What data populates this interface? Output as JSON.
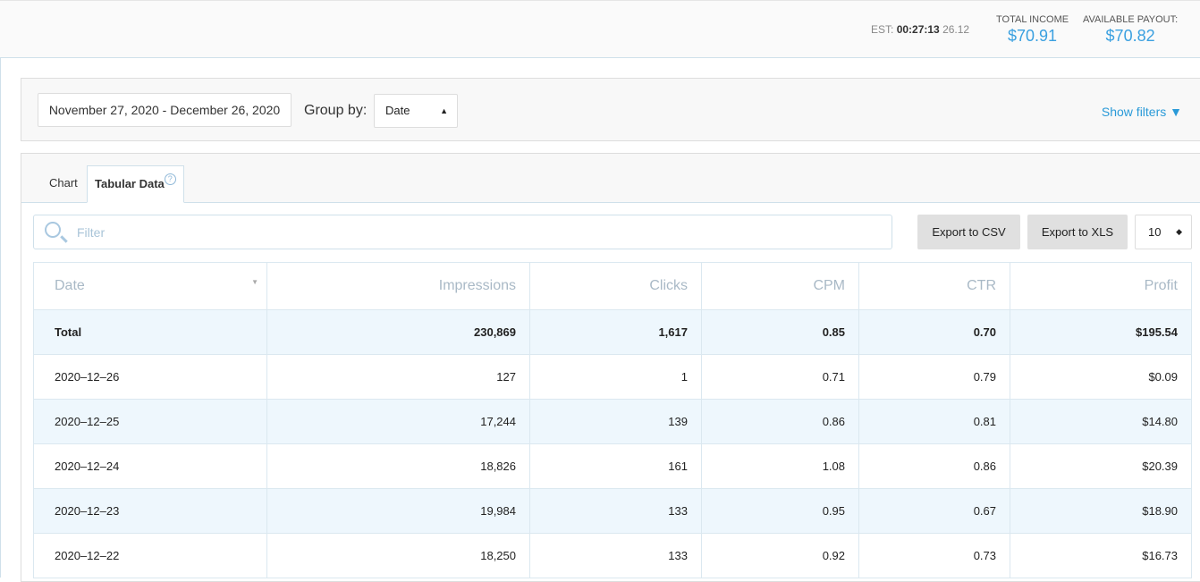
{
  "header": {
    "est_label": "EST:",
    "est_time": "00:27:13",
    "est_date": "26.12",
    "total_income_label": "TOTAL INCOME",
    "total_income": "$70.91",
    "payout_label": "AVAILABLE PAYOUT:",
    "payout": "$70.82"
  },
  "filters": {
    "date_range": "November 27, 2020 - December 26, 2020",
    "group_by_label": "Group by:",
    "group_by_value": "Date",
    "show_filters": "Show filters ▼"
  },
  "tabs": [
    {
      "label": "Chart"
    },
    {
      "label": "Tabular Data"
    }
  ],
  "toolbar": {
    "filter_placeholder": "Filter",
    "export_csv": "Export to CSV",
    "export_xls": "Export to XLS",
    "page_size": "10"
  },
  "table": {
    "columns": [
      "Date",
      "Impressions",
      "Clicks",
      "CPM",
      "CTR",
      "Profit"
    ],
    "rows": [
      [
        "Total",
        "230,869",
        "1,617",
        "0.85",
        "0.70",
        "$195.54"
      ],
      [
        "2020–12–26",
        "127",
        "1",
        "0.71",
        "0.79",
        "$0.09"
      ],
      [
        "2020–12–25",
        "17,244",
        "139",
        "0.86",
        "0.81",
        "$14.80"
      ],
      [
        "2020–12–24",
        "18,826",
        "161",
        "1.08",
        "0.86",
        "$20.39"
      ],
      [
        "2020–12–23",
        "19,984",
        "133",
        "0.95",
        "0.67",
        "$18.90"
      ],
      [
        "2020–12–22",
        "18,250",
        "133",
        "0.92",
        "0.73",
        "$16.73"
      ]
    ]
  }
}
